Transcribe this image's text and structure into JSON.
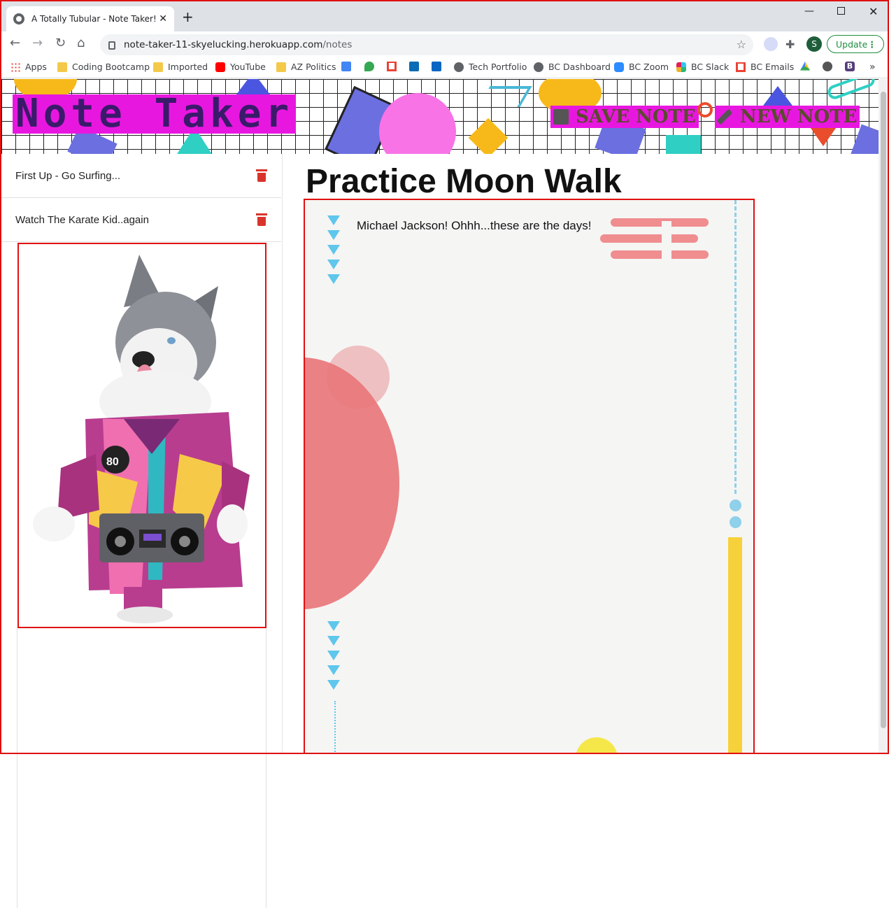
{
  "browser": {
    "tab_title": "A Totally Tubular - Note Taker!",
    "url_host": "note-taker-11-skyelucking.herokuapp.com",
    "url_path": "/notes",
    "profile_initial": "S",
    "update_label": "Update"
  },
  "bookmarks": [
    {
      "label": "Apps",
      "icon": "apps-grid-icon"
    },
    {
      "label": "Coding Bootcamp",
      "icon": "folder-icon"
    },
    {
      "label": "Imported",
      "icon": "folder-icon"
    },
    {
      "label": "YouTube",
      "icon": "youtube-icon"
    },
    {
      "label": "AZ Politics",
      "icon": "folder-icon"
    },
    {
      "label": "Tech Portfolio",
      "icon": "globe-icon"
    },
    {
      "label": "BC Dashboard",
      "icon": "globe-icon"
    },
    {
      "label": "BC Zoom",
      "icon": "zoom-icon"
    },
    {
      "label": "BC Slack",
      "icon": "slack-icon"
    },
    {
      "label": "BC Emails",
      "icon": "gmail-icon"
    }
  ],
  "header": {
    "brand": "Note Taker",
    "save_label": "SAVE NOTE",
    "new_label": "NEW NOTE"
  },
  "notes": [
    {
      "title": "First Up - Go Surfing..."
    },
    {
      "title": "Watch The Karate Kid..again"
    }
  ],
  "active_note": {
    "title": "Practice Moon Walk",
    "text": "Michael Jackson! Ohhh...these are the days!"
  },
  "colors": {
    "brand_magenta": "#e817e0",
    "delete_red": "#d9342b",
    "accent_blue": "#5fc6ec",
    "accent_yellow": "#f7d13a",
    "accent_pink": "#e8767a"
  }
}
